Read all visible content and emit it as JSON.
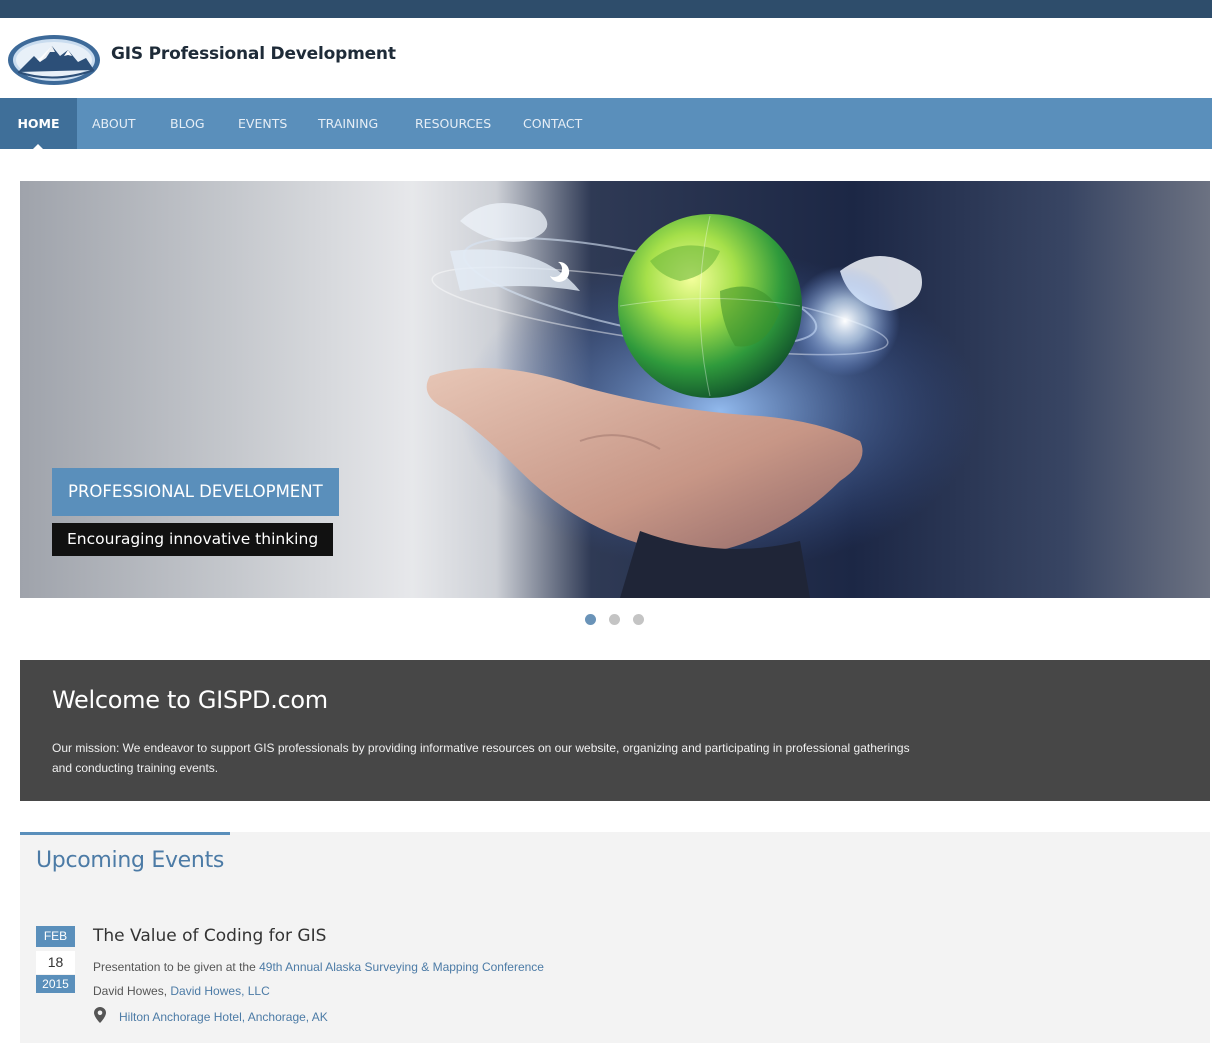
{
  "site": {
    "title": "GIS Professional Development"
  },
  "nav": {
    "items": [
      {
        "label": "HOME",
        "active": true
      },
      {
        "label": "ABOUT"
      },
      {
        "label": "BLOG"
      },
      {
        "label": "EVENTS"
      },
      {
        "label": "TRAINING"
      },
      {
        "label": "RESOURCES"
      },
      {
        "label": "CONTACT"
      }
    ]
  },
  "hero": {
    "caption_title": "PROFESSIONAL DEVELOPMENT",
    "caption_subtitle": "Encouraging innovative thinking",
    "slides": 3,
    "active_slide": 1
  },
  "welcome": {
    "heading": "Welcome to GISPD.com",
    "mission": "Our mission: We endeavor to support GIS professionals by providing informative resources on our website, organizing and participating in professional gatherings and conducting training events."
  },
  "events": {
    "heading": "Upcoming Events",
    "items": [
      {
        "month": "FEB",
        "day": "18",
        "year": "2015",
        "title": "The Value of Coding for GIS",
        "desc_prefix": "Presentation to be given at the ",
        "desc_link": "49th Annual Alaska Surveying & Mapping Conference",
        "presenter": "David Howes, ",
        "presenter_link": "David Howes, LLC",
        "location": "Hilton Anchorage Hotel, Anchorage, AK",
        "location_icon": "map-marker-icon"
      }
    ]
  },
  "colors": {
    "topbar": "#2e4d6b",
    "nav": "#5a8fbb",
    "nav_active": "#3f6f99",
    "welcome_bg": "#474747",
    "accent": "#4c7ba6"
  }
}
